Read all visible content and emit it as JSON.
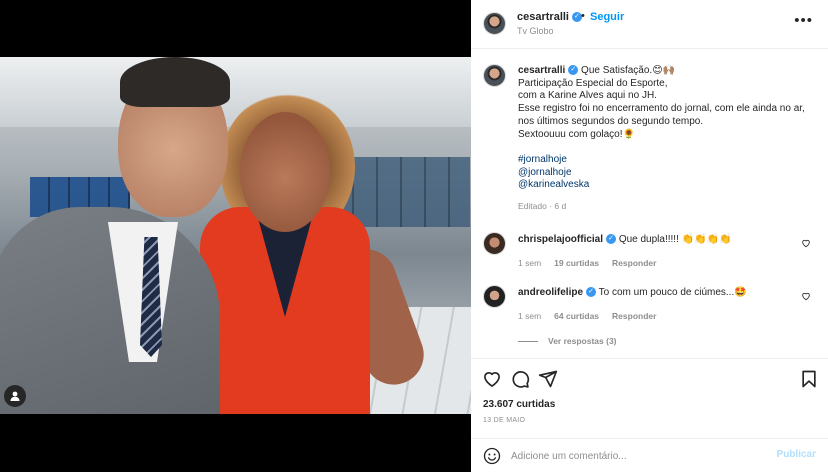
{
  "post": {
    "username": "cesartralli",
    "follow_label": "Seguir",
    "location": "Tv Globo",
    "more_label": "•••"
  },
  "caption": {
    "username": "cesartralli",
    "line1": "Que Satisfação.😊🙌🏽",
    "line2": "Participação Especial do Esporte,",
    "line3": "com a Karine Alves aqui no JH.",
    "line4": "Esse registro foi no encerramento do jornal, com ele ainda no ar,",
    "line5": "nos últimos segundos do segundo tempo.",
    "line6": "Sextoouuu com golaço!🌻",
    "hashtags": [
      "#jornalhoje",
      "@jornalhoje",
      "@karinealveska"
    ],
    "meta": "Editado · 6 d"
  },
  "comments": [
    {
      "username": "chrispelajoofficial",
      "text": "Que dupla!!!!! 👏👏👏👏",
      "time": "1 sem",
      "likes": "19 curtidas",
      "reply": "Responder"
    },
    {
      "username": "andreolifelipe",
      "text": "To com um pouco de ciúmes...🤩",
      "time": "1 sem",
      "likes": "64 curtidas",
      "reply": "Responder"
    }
  ],
  "view_replies": "Ver respostas (3)",
  "likes_count": "23.607 curtidas",
  "date": "13 DE MAIO",
  "add_comment": {
    "placeholder": "Adicione um comentário...",
    "publish_label": "Publicar"
  },
  "colors": {
    "link_blue": "#0095f6",
    "hashtag_blue": "#00376b",
    "muted": "#8e8e8e",
    "publish_disabled": "#b2dffc"
  },
  "icons": {
    "like": "heart-icon",
    "comment": "comment-icon",
    "share": "paper-plane-icon",
    "save": "bookmark-icon",
    "emoji": "emoji-icon",
    "tag": "user-tag-icon",
    "verified": "verified-badge-icon"
  }
}
